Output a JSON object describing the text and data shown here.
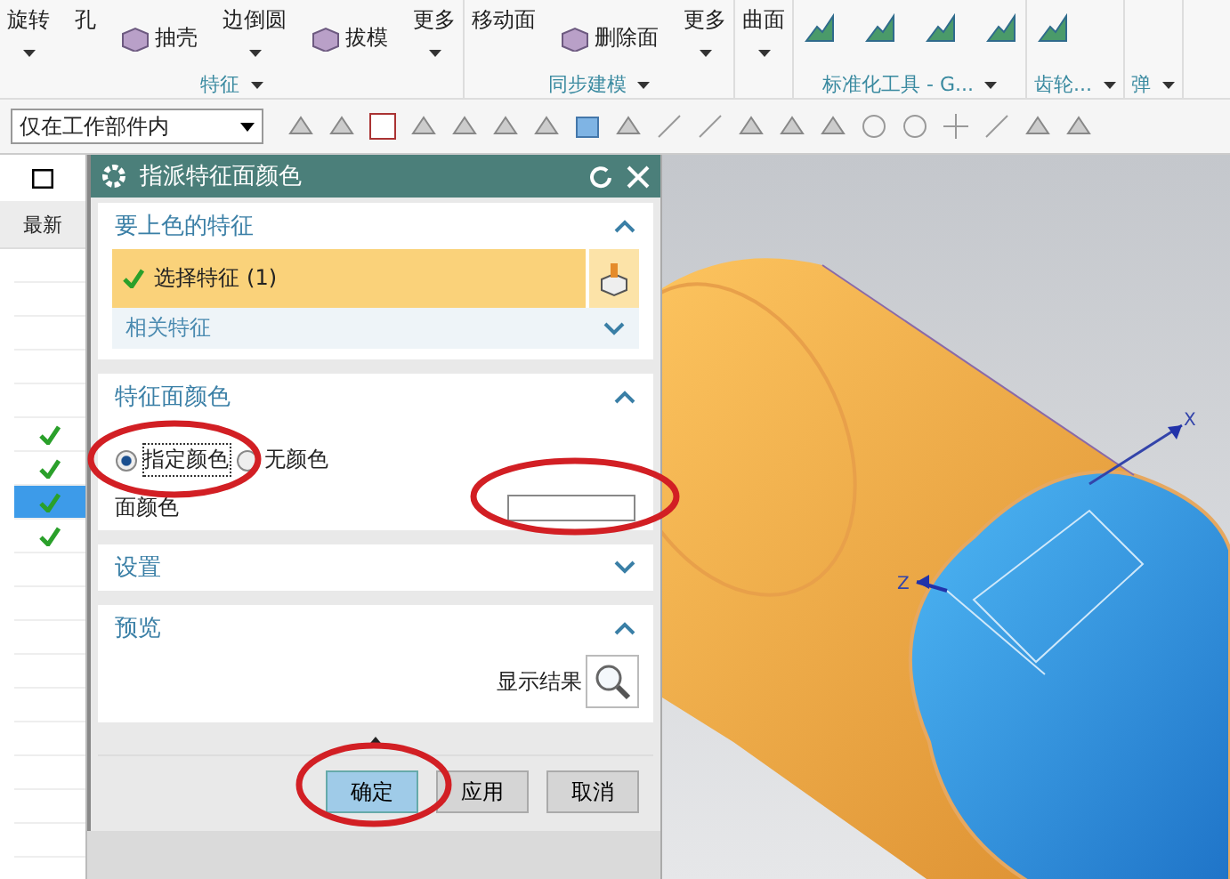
{
  "ribbon": {
    "groups": [
      {
        "label": "特征",
        "items": [
          {
            "kind": "large",
            "label": "旋转",
            "dropdown": true
          },
          {
            "kind": "large",
            "label": "孔",
            "dropdown": false
          },
          {
            "kind": "small",
            "label": "抽壳"
          },
          {
            "kind": "large",
            "label": "边倒圆",
            "dropdown": true
          },
          {
            "kind": "small",
            "label": "拔模"
          },
          {
            "kind": "large",
            "label": "更多",
            "dropdown": true
          }
        ]
      },
      {
        "label": "同步建模",
        "items": [
          {
            "kind": "large",
            "label": "移动面",
            "dropdown": false
          },
          {
            "kind": "small",
            "label": "删除面"
          },
          {
            "kind": "large",
            "label": "更多",
            "dropdown": true
          }
        ]
      },
      {
        "items": [
          {
            "kind": "large",
            "label": "曲面",
            "dropdown": true
          }
        ]
      },
      {
        "label": "标准化工具 - G...",
        "items": [
          {
            "kind": "icon"
          },
          {
            "kind": "icon"
          },
          {
            "kind": "icon"
          },
          {
            "kind": "icon"
          }
        ]
      },
      {
        "label": "齿轮...",
        "items": [
          {
            "kind": "icon"
          }
        ]
      },
      {
        "label": "弹"
      }
    ]
  },
  "toolbar": {
    "scope_filter": "仅在工作部件内"
  },
  "navigator": {
    "column": "最新",
    "rows": [
      {
        "checked": false,
        "selected": false
      },
      {
        "checked": false,
        "selected": false
      },
      {
        "checked": false,
        "selected": false
      },
      {
        "checked": false,
        "selected": false
      },
      {
        "checked": false,
        "selected": false
      },
      {
        "checked": true,
        "selected": false
      },
      {
        "checked": true,
        "selected": false
      },
      {
        "checked": true,
        "selected": true
      },
      {
        "checked": true,
        "selected": false
      },
      {
        "checked": false,
        "selected": false
      },
      {
        "checked": false,
        "selected": false
      },
      {
        "checked": false,
        "selected": false
      },
      {
        "checked": false,
        "selected": false
      },
      {
        "checked": false,
        "selected": false
      },
      {
        "checked": false,
        "selected": false
      },
      {
        "checked": false,
        "selected": false
      },
      {
        "checked": false,
        "selected": false
      },
      {
        "checked": false,
        "selected": false
      }
    ]
  },
  "dialog": {
    "title": "指派特征面颜色",
    "sections": [
      {
        "kind": "select",
        "title": "要上色的特征",
        "expanded": true,
        "selection": "选择特征 (1)",
        "related": "相关特征"
      },
      {
        "kind": "color",
        "title": "特征面颜色",
        "expanded": true,
        "options": [
          {
            "label": "指定颜色",
            "selected": true
          },
          {
            "label": "无颜色",
            "selected": false
          }
        ],
        "color_label": "面颜色"
      },
      {
        "kind": "settings",
        "title": "设置",
        "expanded": false
      },
      {
        "kind": "preview",
        "title": "预览",
        "expanded": true,
        "show_result": "显示结果"
      }
    ],
    "buttons": [
      {
        "label": "确定",
        "default": true
      },
      {
        "label": "应用",
        "default": false
      },
      {
        "label": "取消",
        "default": false
      }
    ]
  },
  "viewport": {
    "triad": {
      "x_label": "X",
      "z_label": "Z"
    }
  }
}
